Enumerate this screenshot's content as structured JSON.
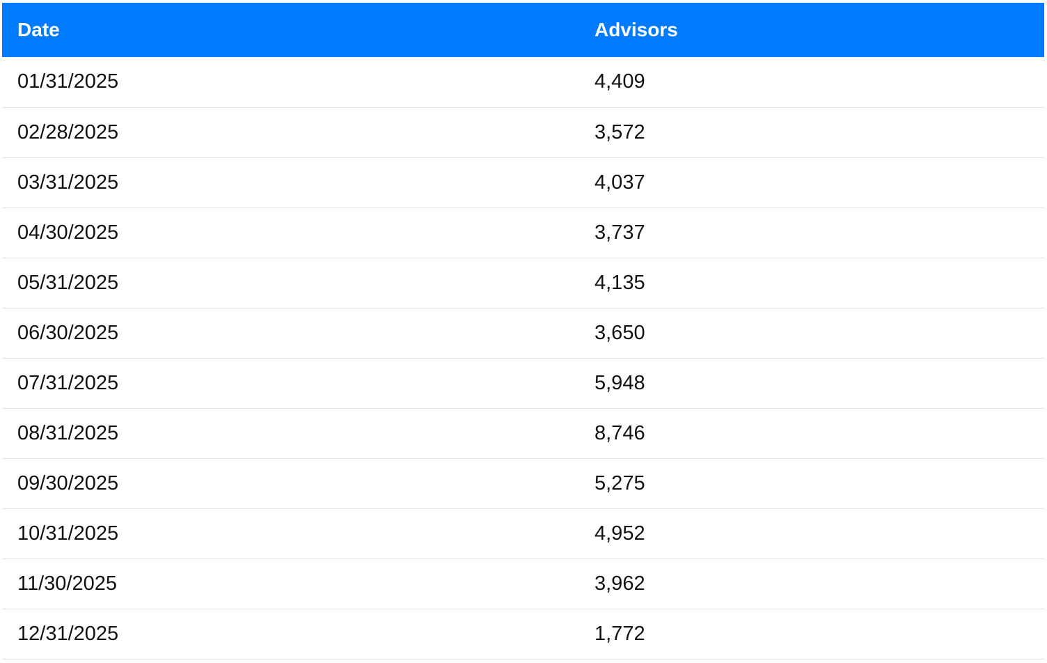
{
  "table": {
    "columns": [
      "Date",
      "Advisors"
    ],
    "rows": [
      [
        "01/31/2025",
        "4,409"
      ],
      [
        "02/28/2025",
        "3,572"
      ],
      [
        "03/31/2025",
        "4,037"
      ],
      [
        "04/30/2025",
        "3,737"
      ],
      [
        "05/31/2025",
        "4,135"
      ],
      [
        "06/30/2025",
        "3,650"
      ],
      [
        "07/31/2025",
        "5,948"
      ],
      [
        "08/31/2025",
        "8,746"
      ],
      [
        "09/30/2025",
        "5,275"
      ],
      [
        "10/31/2025",
        "4,952"
      ],
      [
        "11/30/2025",
        "3,962"
      ],
      [
        "12/31/2025",
        "1,772"
      ]
    ]
  },
  "colors": {
    "header_background": "#007bff",
    "header_text": "#ffffff",
    "row_divider": "#dee2e6"
  }
}
